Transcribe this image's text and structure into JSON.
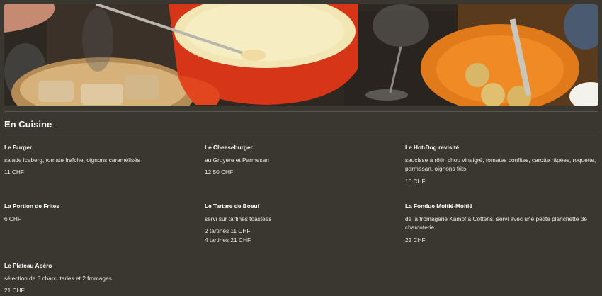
{
  "section": {
    "title": "En Cuisine"
  },
  "hero": {
    "alt": "fondue-hero-image"
  },
  "menu": [
    {
      "name": "Le Burger",
      "description": "salade iceberg, tomate fraîche, oignons caramélisés",
      "prices": [
        "11 CHF"
      ]
    },
    {
      "name": "Le Cheeseburger",
      "description": "au Gruyère et Parmesan",
      "prices": [
        "12.50 CHF"
      ]
    },
    {
      "name": "Le Hot-Dog revisité",
      "description": "saucisse à rôtir, chou vinaigré, tomates confites, carotte râpées, roquette, parmesan, oignons frits",
      "prices": [
        "10 CHF"
      ]
    },
    {
      "name": "La Portion de Frites",
      "description": "",
      "prices": [
        "6 CHF"
      ]
    },
    {
      "name": "Le Tartare de Boeuf",
      "description": "servi sur tartines toastées",
      "prices": [
        "2 tartines 11 CHF",
        "4 tartines 21 CHF"
      ]
    },
    {
      "name": "La Fondue Moitié-Moitié",
      "description": "de la fromagerie Kämpf à Cottens, servi avec une petite planchette de charcuterie",
      "prices": [
        "22 CHF"
      ]
    },
    {
      "name": "Le Plateau Apéro",
      "description": "sélection de 5 charcuteries et 2 fromages",
      "prices": [
        "21 CHF"
      ]
    }
  ]
}
